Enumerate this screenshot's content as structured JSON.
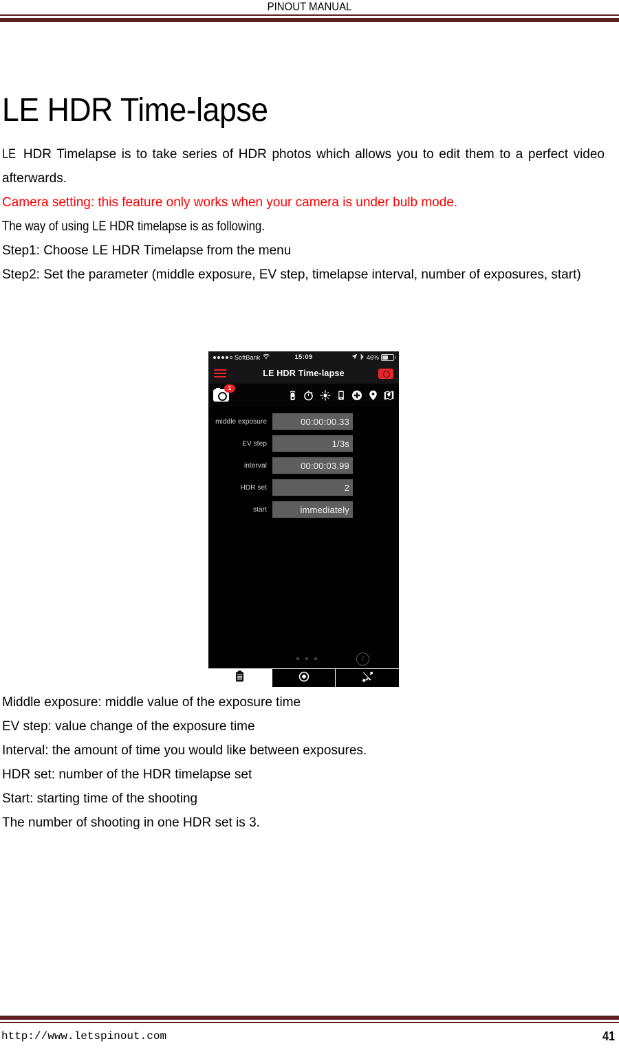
{
  "header": {
    "title": "PINOUT MANUAL"
  },
  "doc": {
    "title": "LE HDR Time-lapse",
    "intro_line1_lead": "LE",
    "intro_line1": " HDR Timelapse is to take series of HDR photos which allows you to edit them to a perfect video afterwards.",
    "warning": "Camera setting: this feature only works when your camera is under bulb mode.",
    "usage_lead": "The way of using ",
    "usage_le": "LE",
    "usage_tail": " HDR timelapse is as following.",
    "step1": "Step1: Choose LE HDR Timelapse from the menu",
    "step2": "Step2: Set the parameter (middle exposure, EV step, timelapse interval, number of exposures, start)",
    "defs": [
      "Middle exposure: middle value of the exposure time",
      "EV step: value change of the exposure time",
      "Interval: the amount of time you would like between exposures.",
      "HDR set: number of the HDR timelapse set",
      "Start: starting time of the shooting",
      "The number of shooting in one HDR set is 3."
    ]
  },
  "phone": {
    "status": {
      "carrier": "SoftBank",
      "time": "15:09",
      "battery_percent": "46%",
      "signal_dots": 5,
      "wifi_icon": "wifi-icon",
      "location_icon": "location-arrow-icon",
      "bluetooth_icon": "bluetooth-icon",
      "battery_icon": "battery-icon"
    },
    "nav": {
      "menu_icon": "hamburger-menu-icon",
      "title": "LE HDR Time-lapse",
      "camera_icon": "camera-icon"
    },
    "toolbar": {
      "camera_label": "camera-shots-icon",
      "badge": "1",
      "icons": [
        "wireless-remote-icon",
        "stopwatch-icon",
        "focus-target-icon",
        "device-icon",
        "plus-circle-icon",
        "location-pin-icon",
        "map-pin-icon"
      ]
    },
    "params": [
      {
        "label": "middle exposure",
        "value": "00:00:00.33"
      },
      {
        "label": "EV step",
        "value": "1/3s"
      },
      {
        "label": "interval",
        "value": "00:00:03.99"
      },
      {
        "label": "HDR set",
        "value": "2"
      },
      {
        "label": "start",
        "value": "immediately"
      }
    ],
    "page_dots": 3,
    "info_icon": "info-icon",
    "info_glyph": "i",
    "tabs": [
      {
        "icon": "clipboard-icon",
        "active": true
      },
      {
        "icon": "record-circle-icon",
        "active": false
      },
      {
        "icon": "tools-wrench-icon",
        "active": false
      }
    ]
  },
  "footer": {
    "url": "http://www.letspinout.com",
    "page_number": "41"
  },
  "colors": {
    "rule": "#5c1f1f",
    "warning_text": "#ff0000",
    "accent_red": "#e8252b",
    "param_field": "#5e5e5e"
  }
}
